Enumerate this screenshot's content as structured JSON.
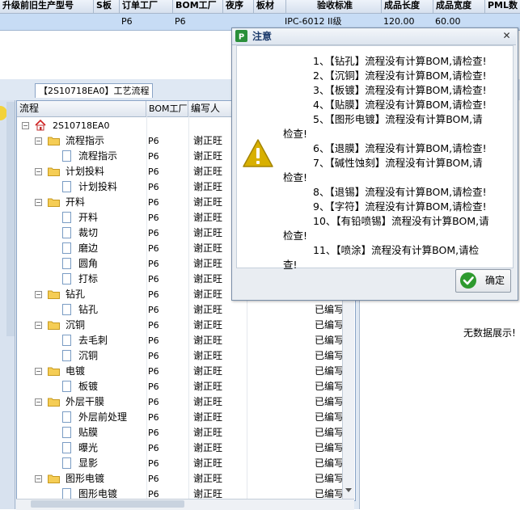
{
  "grid": {
    "headers": [
      "升级前旧生产型号",
      "S板",
      "订单工厂",
      "BOM工厂",
      "夜序",
      "板材",
      "验收标准",
      "成品长度",
      "成品宽度",
      "PML数"
    ],
    "row": {
      "order_factory": "P6",
      "bom_factory": "P6",
      "standard": "IPC-6012 II级",
      "length": "120.00",
      "width": "60.00"
    }
  },
  "tab": {
    "label": "【2S10718EA0】工艺流程"
  },
  "tree": {
    "columns": [
      "流程",
      "BOM工厂",
      "编写人"
    ],
    "root": "2S10718EA0",
    "rows": [
      {
        "label": "流程指示",
        "level": 1,
        "type": "folder",
        "bom": "P6",
        "writer": "谢正旺",
        "status": ""
      },
      {
        "label": "流程指示",
        "level": 2,
        "type": "doc",
        "bom": "P6",
        "writer": "谢正旺",
        "status": ""
      },
      {
        "label": "计划投料",
        "level": 1,
        "type": "folder",
        "bom": "P6",
        "writer": "谢正旺",
        "status": ""
      },
      {
        "label": "计划投料",
        "level": 2,
        "type": "doc",
        "bom": "P6",
        "writer": "谢正旺",
        "status": ""
      },
      {
        "label": "开料",
        "level": 1,
        "type": "folder",
        "bom": "P6",
        "writer": "谢正旺",
        "status": ""
      },
      {
        "label": "开料",
        "level": 2,
        "type": "doc",
        "bom": "P6",
        "writer": "谢正旺",
        "status": ""
      },
      {
        "label": "裁切",
        "level": 2,
        "type": "doc",
        "bom": "P6",
        "writer": "谢正旺",
        "status": ""
      },
      {
        "label": "磨边",
        "level": 2,
        "type": "doc",
        "bom": "P6",
        "writer": "谢正旺",
        "status": ""
      },
      {
        "label": "圆角",
        "level": 2,
        "type": "doc",
        "bom": "P6",
        "writer": "谢正旺",
        "status": ""
      },
      {
        "label": "打标",
        "level": 2,
        "type": "doc",
        "bom": "P6",
        "writer": "谢正旺",
        "status": ""
      },
      {
        "label": "钻孔",
        "level": 1,
        "type": "folder",
        "bom": "P6",
        "writer": "谢正旺",
        "status": ""
      },
      {
        "label": "钻孔",
        "level": 2,
        "type": "doc",
        "bom": "P6",
        "writer": "谢正旺",
        "status": "已编写"
      },
      {
        "label": "沉铜",
        "level": 1,
        "type": "folder",
        "bom": "P6",
        "writer": "谢正旺",
        "status": "已编写"
      },
      {
        "label": "去毛刺",
        "level": 2,
        "type": "doc",
        "bom": "P6",
        "writer": "谢正旺",
        "status": "已编写"
      },
      {
        "label": "沉铜",
        "level": 2,
        "type": "doc",
        "bom": "P6",
        "writer": "谢正旺",
        "status": "已编写"
      },
      {
        "label": "电镀",
        "level": 1,
        "type": "folder",
        "bom": "P6",
        "writer": "谢正旺",
        "status": "已编写"
      },
      {
        "label": "板镀",
        "level": 2,
        "type": "doc",
        "bom": "P6",
        "writer": "谢正旺",
        "status": "已编写"
      },
      {
        "label": "外层干膜",
        "level": 1,
        "type": "folder",
        "bom": "P6",
        "writer": "谢正旺",
        "status": "已编写"
      },
      {
        "label": "外层前处理",
        "level": 2,
        "type": "doc",
        "bom": "P6",
        "writer": "谢正旺",
        "status": "已编写"
      },
      {
        "label": "贴膜",
        "level": 2,
        "type": "doc",
        "bom": "P6",
        "writer": "谢正旺",
        "status": "已编写"
      },
      {
        "label": "曝光",
        "level": 2,
        "type": "doc",
        "bom": "P6",
        "writer": "谢正旺",
        "status": "已编写"
      },
      {
        "label": "显影",
        "level": 2,
        "type": "doc",
        "bom": "P6",
        "writer": "谢正旺",
        "status": "已编写"
      },
      {
        "label": "图形电镀",
        "level": 1,
        "type": "folder",
        "bom": "P6",
        "writer": "谢正旺",
        "status": "已编写"
      },
      {
        "label": "图形电镀",
        "level": 2,
        "type": "doc",
        "bom": "P6",
        "writer": "谢正旺",
        "status": "已编写"
      }
    ]
  },
  "right_panel": {
    "empty_text": "无数据展示!"
  },
  "dialog": {
    "title": "注意",
    "messages": [
      "1、【钻孔】流程没有计算BOM,请检查!",
      "2、【沉铜】流程没有计算BOM,请检查!",
      "3、【板镀】流程没有计算BOM,请检查!",
      "4、【贴膜】流程没有计算BOM,请检查!",
      "5、【图形电镀】流程没有计算BOM,请",
      "检查!",
      "6、【退膜】流程没有计算BOM,请检查!",
      "7、【碱性蚀刻】流程没有计算BOM,请",
      "检查!",
      "8、【退锡】流程没有计算BOM,请检查!",
      "9、【字符】流程没有计算BOM,请检查!",
      "10、【有铅喷锡】流程没有计算BOM,请",
      "检查!",
      "11、【喷涂】流程没有计算BOM,请检",
      "查!"
    ],
    "ok_label": "确定"
  },
  "colors": {
    "selected_row": "#c7dcf5",
    "warning": "#d8b000",
    "ok_green": "#2e9a2e"
  }
}
